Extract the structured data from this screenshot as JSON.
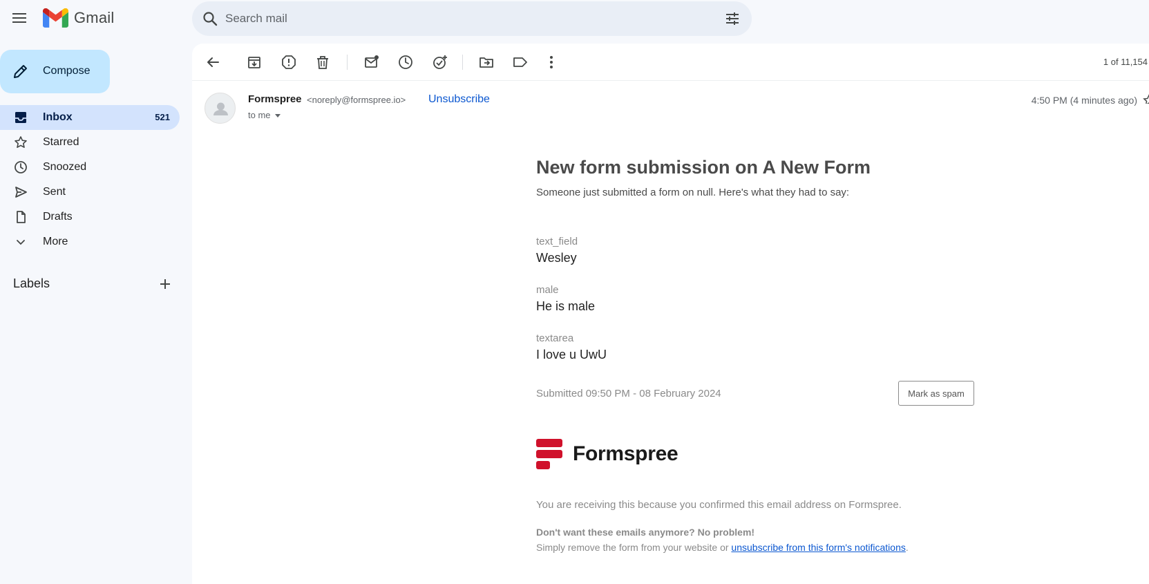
{
  "app": {
    "name": "Gmail"
  },
  "search": {
    "placeholder": "Search mail"
  },
  "compose": {
    "label": "Compose"
  },
  "sidebar": {
    "items": [
      {
        "label": "Inbox",
        "count": "521",
        "icon": "inbox-icon",
        "active": true
      },
      {
        "label": "Starred",
        "count": "",
        "icon": "star-icon"
      },
      {
        "label": "Snoozed",
        "count": "",
        "icon": "clock-icon"
      },
      {
        "label": "Sent",
        "count": "",
        "icon": "send-icon"
      },
      {
        "label": "Drafts",
        "count": "",
        "icon": "draft-icon"
      },
      {
        "label": "More",
        "count": "",
        "icon": "chevron-down-icon"
      }
    ],
    "labels_title": "Labels"
  },
  "toolbar": {
    "pager": "1 of 11,154"
  },
  "message": {
    "sender_name": "Formspree",
    "sender_email": "<noreply@formspree.io>",
    "unsubscribe": "Unsubscribe",
    "to": "to me",
    "time": "4:50 PM (4 minutes ago)"
  },
  "email": {
    "headline": "New form submission on A New Form",
    "subline": "Someone just submitted a form on null. Here's what they had to say:",
    "fields": [
      {
        "label": "text_field",
        "value": "Wesley"
      },
      {
        "label": "male",
        "value": "He is male"
      },
      {
        "label": "textarea",
        "value": "I love u UwU"
      }
    ],
    "submitted": "Submitted 09:50 PM - 08 February 2024",
    "spam_button": "Mark as spam",
    "brand": "Formspree",
    "footer_notice": "You are receiving this because you confirmed this email address on Formspree.",
    "footer_bold": "Don't want these emails anymore? No problem!",
    "footer_text": "Simply remove the form from your website or ",
    "footer_link": "unsubscribe from this form's notifications",
    "footer_end": "."
  },
  "colors": {
    "background": "#f6f8fc",
    "compose_bg": "#c2e7ff",
    "active_nav": "#d3e3fd",
    "link": "#0b57d0",
    "formspree_red": "#d0112b"
  }
}
